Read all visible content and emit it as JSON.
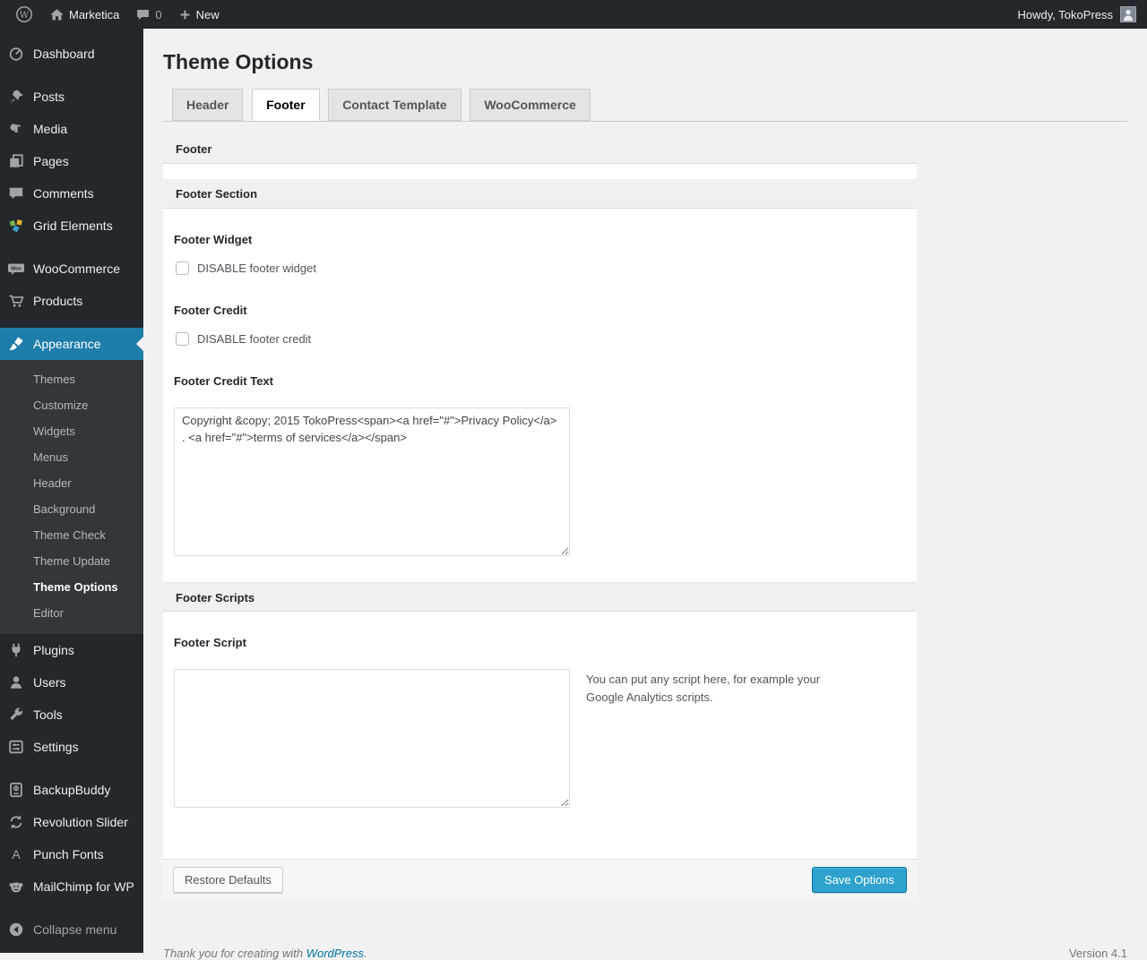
{
  "admin_bar": {
    "wp_logo_letter": "W",
    "site_name": "Marketica",
    "comment_count": "0",
    "new_label": "New",
    "howdy": "Howdy, TokoPress"
  },
  "sidebar": {
    "items": [
      {
        "label": "Dashboard",
        "icon": "dashboard-icon"
      },
      {
        "label": "Posts",
        "icon": "pin-icon"
      },
      {
        "label": "Media",
        "icon": "media-icon"
      },
      {
        "label": "Pages",
        "icon": "pages-icon"
      },
      {
        "label": "Comments",
        "icon": "comments-bubble-icon"
      },
      {
        "label": "Grid Elements",
        "icon": "grid-elements-icon"
      },
      {
        "label": "WooCommerce",
        "icon": "woocommerce-badge-icon"
      },
      {
        "label": "Products",
        "icon": "cart-icon"
      },
      {
        "label": "Appearance",
        "icon": "brush-icon",
        "current": true
      },
      {
        "label": "Plugins",
        "icon": "plug-icon"
      },
      {
        "label": "Users",
        "icon": "user-icon"
      },
      {
        "label": "Tools",
        "icon": "wrench-icon"
      },
      {
        "label": "Settings",
        "icon": "sliders-icon"
      },
      {
        "label": "BackupBuddy",
        "icon": "backup-drive-icon"
      },
      {
        "label": "Revolution Slider",
        "icon": "refresh-arrows-icon"
      },
      {
        "label": "Punch Fonts",
        "icon": "letter-a-icon"
      },
      {
        "label": "MailChimp for WP",
        "icon": "monkey-icon"
      },
      {
        "label": "Collapse menu",
        "icon": "collapse-arrow-icon"
      }
    ],
    "woo_badge_text": "Woo",
    "punch_icon_letter": "A",
    "appearance_submenu": [
      {
        "label": "Themes"
      },
      {
        "label": "Customize"
      },
      {
        "label": "Widgets"
      },
      {
        "label": "Menus"
      },
      {
        "label": "Header"
      },
      {
        "label": "Background"
      },
      {
        "label": "Theme Check"
      },
      {
        "label": "Theme Update"
      },
      {
        "label": "Theme Options",
        "current": true
      },
      {
        "label": "Editor"
      }
    ]
  },
  "page": {
    "title": "Theme Options",
    "tabs": [
      {
        "label": "Header",
        "active": false
      },
      {
        "label": "Footer",
        "active": true
      },
      {
        "label": "Contact Template",
        "active": false
      },
      {
        "label": "WooCommerce",
        "active": false
      }
    ],
    "panel": {
      "footer_bar_title": "Footer",
      "footer_section_title": "Footer Section",
      "footer_widget_label": "Footer Widget",
      "footer_widget_checkbox_label": "DISABLE footer widget",
      "footer_widget_checked": false,
      "footer_credit_label": "Footer Credit",
      "footer_credit_checkbox_label": "DISABLE footer credit",
      "footer_credit_checked": false,
      "footer_credit_text_label": "Footer Credit Text",
      "footer_credit_text_value": "Copyright &copy; 2015 TokoPress<span><a href=\"#\">Privacy Policy</a> . <a href=\"#\">terms of services</a></span>",
      "footer_scripts_title": "Footer Scripts",
      "footer_script_label": "Footer Script",
      "footer_script_value": "",
      "footer_script_hint": "You can put any script here, for example your Google Analytics scripts.",
      "restore_button_label": "Restore Defaults",
      "save_button_label": "Save Options"
    }
  },
  "page_footer": {
    "thanks_prefix": "Thank you for creating with ",
    "wordpress_link": "WordPress",
    "thanks_suffix": ".",
    "version": "Version 4.1"
  },
  "colors": {
    "adminbar_bg": "#23282d",
    "sidebar_bg": "#23282d",
    "submenu_bg": "#32373c",
    "menu_highlight": "#1e7dab",
    "primary_button": "#2ea2cc",
    "page_bg": "#f1f1f1",
    "link": "#0074a2"
  }
}
